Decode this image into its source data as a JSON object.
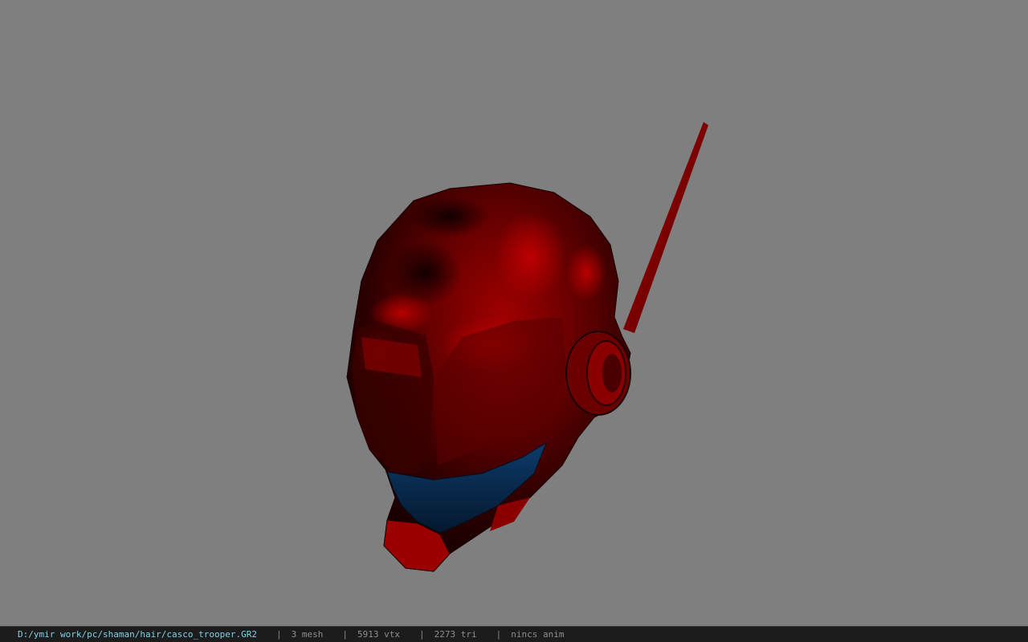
{
  "viewport": {
    "background_color": "#7f7f7f",
    "model": {
      "name": "helmet-model",
      "primary_color": "#b00000",
      "shadow_color": "#1a0000",
      "visor_color": "#0e2a52"
    }
  },
  "statusbar": {
    "file_path": "D:/ymir work/pc/shaman/hair/casco_trooper.GR2",
    "separator": "|",
    "mesh_count": "3 mesh",
    "vertex_count": "5913 vtx",
    "triangle_count": "2273 tri",
    "animation": "nincs anim",
    "path_color": "#7fd0e6",
    "stat_color": "#8e8e8e"
  }
}
